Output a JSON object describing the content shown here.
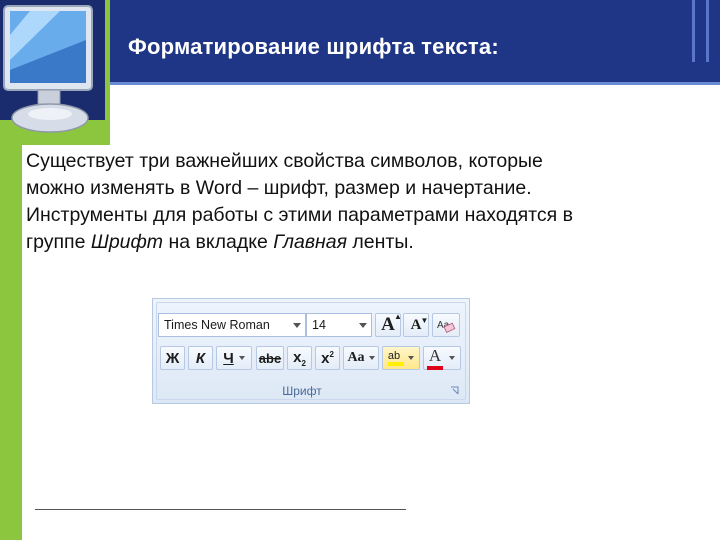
{
  "header": {
    "title": "Форматирование шрифта текста:"
  },
  "body": {
    "lines": [
      "Существует три важнейших свойства символов, которые",
      "можно изменять в Word – шрифт, размер и начертание.",
      "Инструменты для работы с этими параметрами находятся в"
    ],
    "last_line": {
      "prefix": "группе ",
      "italic1": "Шрифт",
      "middle": " на вкладке ",
      "italic2": "Главная",
      "suffix": " ленты."
    }
  },
  "ribbon": {
    "font_name": "Times New Roman",
    "font_size": "14",
    "group_label": "Шрифт",
    "buttons": {
      "grow": "A",
      "shrink": "A",
      "bold": "Ж",
      "italic": "К",
      "underline": "Ч",
      "strike": "abe",
      "subscript": "x",
      "superscript": "x",
      "change_case": "Aa",
      "highlight": "ab",
      "font_color": "A"
    },
    "colors": {
      "highlight": "#ffef00",
      "font_color": "#e0001a"
    },
    "icons": [
      "grow-font-icon",
      "shrink-font-icon",
      "clear-formatting-icon",
      "dialog-launcher-icon",
      "monitor-icon"
    ]
  }
}
